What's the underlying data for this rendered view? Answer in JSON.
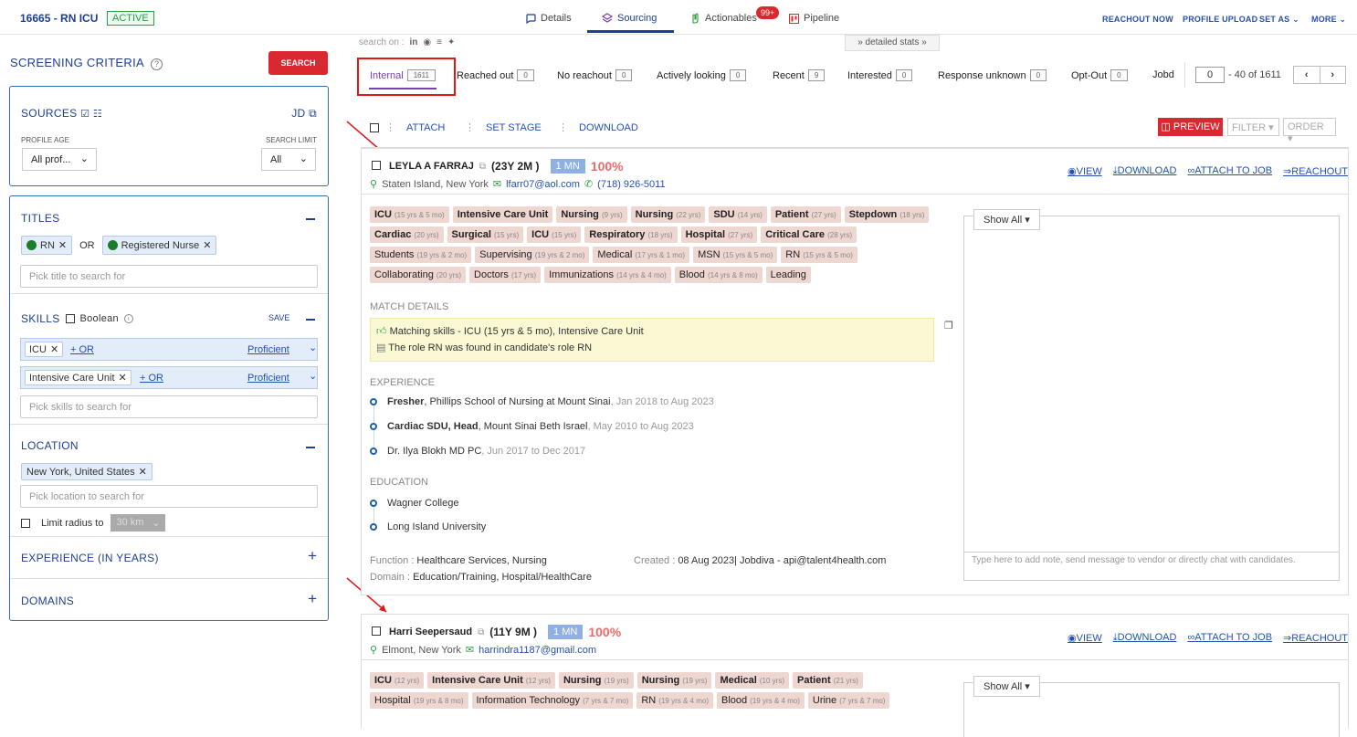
{
  "header": {
    "job_id": "16665 - RN ICU",
    "status": "ACTIVE",
    "tabs": [
      {
        "label": "Details",
        "icon": "message-icon"
      },
      {
        "label": "Sourcing",
        "icon": "layers-icon"
      },
      {
        "label": "Actionables",
        "icon": "hand-icon"
      },
      {
        "label": "Pipeline",
        "icon": "pipeline-icon"
      }
    ],
    "notification_count": "99+",
    "right_links": [
      "REACHOUT NOW",
      "PROFILE UPLOAD",
      "SET AS",
      "MORE"
    ]
  },
  "left": {
    "title": "SCREENING CRITERIA",
    "search_button": "SEARCH",
    "sources": {
      "label": "SOURCES",
      "jd": "JD",
      "profile_age_label": "PROFILE AGE",
      "profile_age_value": "All prof...",
      "search_limit_label": "SEARCH LIMIT",
      "search_limit_value": "All"
    },
    "titles": {
      "label": "TITLES",
      "chip1": "RN",
      "or": "OR",
      "chip2": "Registered Nurse",
      "placeholder": "Pick title to search for"
    },
    "skills": {
      "label": "SKILLS",
      "boolean": "Boolean",
      "save": "SAVE",
      "rows": [
        {
          "skill": "ICU",
          "or": "+ OR",
          "level": "Proficient"
        },
        {
          "skill": "Intensive Care Unit",
          "or": "+ OR",
          "level": "Proficient"
        }
      ],
      "placeholder": "Pick skills to search for"
    },
    "location": {
      "label": "LOCATION",
      "chip": "New York, United States",
      "placeholder": "Pick location to search for",
      "radius_label": "Limit radius to",
      "radius_value": "30 km"
    },
    "experience": "EXPERIENCE (IN YEARS)",
    "domains": "DOMAINS"
  },
  "main": {
    "search_on": "search on :",
    "detailed_stats": "detailed stats",
    "filter_tabs": [
      {
        "label": "Internal",
        "count": "1611"
      },
      {
        "label": "Reached out",
        "count": "0"
      },
      {
        "label": "No reachout",
        "count": "0"
      },
      {
        "label": "Actively looking",
        "count": "0"
      },
      {
        "label": "Recent",
        "count": "9"
      },
      {
        "label": "Interested",
        "count": "0"
      },
      {
        "label": "Response unknown",
        "count": "0"
      },
      {
        "label": "Opt-Out",
        "count": "0"
      },
      {
        "label": "Jobd",
        "count": ""
      }
    ],
    "pager_value": "0",
    "pager_text": "- 40 of 1611",
    "actions": {
      "attach": "ATTACH",
      "stage": "SET STAGE",
      "download": "DOWNLOAD",
      "preview": "PREVIEW",
      "filter": "FILTER",
      "order": "ORDER"
    }
  },
  "cards": [
    {
      "name": "LEYLA A FARRAJ",
      "exp": "(23Y 2M )",
      "mn": "1 MN",
      "pct": "100%",
      "location": "Staten Island, New York",
      "email": "lfarr07@aol.com",
      "phone": "(718) 926-5011",
      "links": [
        "VIEW",
        "DOWNLOAD",
        "ATTACH TO JOB",
        "REACHOUT"
      ],
      "tags": [
        {
          "t": "ICU",
          "d": "(15 yrs & 5 mo)",
          "b": true
        },
        {
          "t": "Intensive Care Unit",
          "d": "",
          "b": true
        },
        {
          "t": "Nursing",
          "d": "(9 yrs)",
          "b": true
        },
        {
          "t": "Nursing",
          "d": "(22 yrs)",
          "b": true
        },
        {
          "t": "SDU",
          "d": "(14 yrs)",
          "b": true
        },
        {
          "t": "Patient",
          "d": "(27 yrs)",
          "b": true
        },
        {
          "t": "Stepdown",
          "d": "(18 yrs)",
          "b": true
        },
        {
          "t": "Cardiac",
          "d": "(20 yrs)",
          "b": true
        },
        {
          "t": "Surgical",
          "d": "(15 yrs)",
          "b": true
        },
        {
          "t": "ICU",
          "d": "(15 yrs)",
          "b": true
        },
        {
          "t": "Respiratory",
          "d": "(18 yrs)",
          "b": true
        },
        {
          "t": "Hospital",
          "d": "(27 yrs)",
          "b": true
        },
        {
          "t": "Critical Care",
          "d": "(28 yrs)",
          "b": true
        },
        {
          "t": "Students",
          "d": "(19 yrs & 2 mo)",
          "b": false
        },
        {
          "t": "Supervising",
          "d": "(19 yrs & 2 mo)",
          "b": false
        },
        {
          "t": "Medical",
          "d": "(17 yrs & 1 mo)",
          "b": false
        },
        {
          "t": "MSN",
          "d": "(15 yrs & 5 mo)",
          "b": false
        },
        {
          "t": "RN",
          "d": "(15 yrs & 5 mo)",
          "b": false
        },
        {
          "t": "Collaborating",
          "d": "(20 yrs)",
          "b": false
        },
        {
          "t": "Doctors",
          "d": "(17 yrs)",
          "b": false
        },
        {
          "t": "Immunizations",
          "d": "(14 yrs & 4 mo)",
          "b": false
        },
        {
          "t": "Blood",
          "d": "(14 yrs & 8 mo)",
          "b": false
        },
        {
          "t": "Leading",
          "d": "",
          "b": false
        }
      ],
      "match_label": "MATCH DETAILS",
      "match1": "Matching skills - ICU (15 yrs & 5 mo), Intensive Care Unit",
      "match2": "The role RN was found in candidate's role RN",
      "experience_label": "EXPERIENCE",
      "experience": [
        {
          "title": "Fresher",
          "org": ", Phillips School of Nursing at Mount Sinai",
          "dates": ", Jan 2018 to Aug 2023"
        },
        {
          "title": "Cardiac SDU, Head",
          "org": ", Mount Sinai Beth Israel",
          "dates": ", May 2010 to Aug 2023"
        },
        {
          "title": "",
          "org": "Dr. Ilya Blokh MD PC",
          "dates": ", Jun 2017 to Dec 2017"
        }
      ],
      "education_label": "EDUCATION",
      "education": [
        "Wagner College",
        "Long Island University"
      ],
      "function_label": "Function :",
      "function": "Healthcare Services, Nursing",
      "domain_label": "Domain :",
      "domain": "Education/Training, Hospital/HealthCare",
      "created_label": "Created :",
      "created": "08 Aug 2023| Jobdiva - api@talent4health.com",
      "show_all": "Show All",
      "note_placeholder": "Type here to add note, send message to vendor or directly chat with candidates."
    },
    {
      "name": "Harri Seepersaud",
      "exp": "(11Y 9M )",
      "mn": "1 MN",
      "pct": "100%",
      "location": "Elmont, New York",
      "email": "harrindra1187@gmail.com",
      "links": [
        "VIEW",
        "DOWNLOAD",
        "ATTACH TO JOB",
        "REACHOUT"
      ],
      "tags": [
        {
          "t": "ICU",
          "d": "(12 yrs)",
          "b": true
        },
        {
          "t": "Intensive Care Unit",
          "d": "(12 yrs)",
          "b": true
        },
        {
          "t": "Nursing",
          "d": "(19 yrs)",
          "b": true
        },
        {
          "t": "Nursing",
          "d": "(19 yrs)",
          "b": true
        },
        {
          "t": "Medical",
          "d": "(10 yrs)",
          "b": true
        },
        {
          "t": "Patient",
          "d": "(21 yrs)",
          "b": true
        },
        {
          "t": "Hospital",
          "d": "(19 yrs & 8 mo)",
          "b": false
        },
        {
          "t": "Information Technology",
          "d": "(7 yrs & 7 mo)",
          "b": false
        },
        {
          "t": "RN",
          "d": "(19 yrs & 4 mo)",
          "b": false
        },
        {
          "t": "Blood",
          "d": "(19 yrs & 4 mo)",
          "b": false
        },
        {
          "t": "Urine",
          "d": "(7 yrs & 7 mo)",
          "b": false
        }
      ],
      "show_all": "Show All"
    }
  ]
}
